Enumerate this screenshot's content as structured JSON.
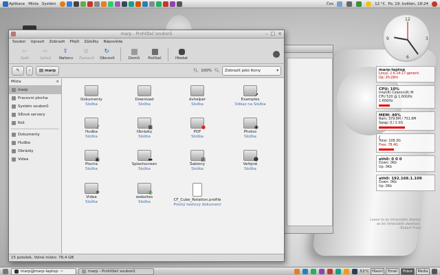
{
  "top_panel": {
    "menus": [
      "Aplikace",
      "Místa",
      "Systém"
    ],
    "keyboard": "Čes",
    "weather": "12 °C",
    "datetime": "Po. 19. květen, 18:24"
  },
  "window": {
    "title": "marp - Prohlížeč souborů",
    "menu": [
      "Soubor",
      "Upravit",
      "Zobrazit",
      "Přejít",
      "Záložky",
      "Nápověda"
    ],
    "toolbar": {
      "back": "Zpět",
      "forward": "Vpřed",
      "up": "Nahoru",
      "stop": "Zastavit",
      "reload": "Obnovit",
      "home": "Domů",
      "computer": "Počítač",
      "search": "Hledat"
    },
    "location": {
      "crumb": "marp",
      "zoom": "100%",
      "view": "Zobrazit jako ikony"
    },
    "sidebar": {
      "header": "Místa",
      "items": [
        "marp",
        "Pracovní plocha",
        "Systém souborů",
        "Síťové servery",
        "Koš"
      ],
      "bookmarks": [
        "Dokumenty",
        "Hudba",
        "Obrázky",
        "Videa"
      ]
    },
    "files": [
      {
        "name": "Dokumenty",
        "type": "Složka"
      },
      {
        "name": "Download",
        "type": "Složka"
      },
      {
        "name": "dvhelper",
        "type": "Složka"
      },
      {
        "name": "Examples",
        "type": "Odkaz na Složka"
      },
      {
        "name": "Hudba",
        "type": "Složka"
      },
      {
        "name": "Obrázky",
        "type": "Složka"
      },
      {
        "name": "PDF",
        "type": "Složka"
      },
      {
        "name": "Photos",
        "type": "Složka"
      },
      {
        "name": "Plocha",
        "type": "Složka"
      },
      {
        "name": "Splashscreen",
        "type": "Složka"
      },
      {
        "name": "Šablony",
        "type": "Složka"
      },
      {
        "name": "Veřejné",
        "type": "Složka"
      },
      {
        "name": "Videa",
        "type": "Složka"
      },
      {
        "name": "websites",
        "type": "Složka"
      },
      {
        "name": "CF_Cube_Rotation.profile",
        "type": "Prostý textový dokument"
      }
    ],
    "status": "15 položek, Volné místo: 78,4 GB"
  },
  "conky": {
    "host": "marp-laptop",
    "kernel": "Linux: 2.6.24-17-generic",
    "uptime": "Up: 2h:28m",
    "cpu": {
      "title": "CPU: 10%",
      "l1": "Intel(R) Celeron(R) M",
      "l2": "CPU   520  @ 1.60GHz",
      "l3": "1.60GHz    "
    },
    "mem": {
      "title": "MEM: 49%",
      "l1": "Ram: 379.9M / 751.6M",
      "l2": "Swap: 0 / 2.0G"
    },
    "disk": {
      "l1": "/",
      "l2": "Total: 108.3G",
      "l3": "Free: 78.4G"
    },
    "eth0": {
      "title": "eth0: 0 0 0",
      "l1": "Down: 0Kb",
      "l2": "Up: 0Kb"
    },
    "ath0": {
      "title": "ath0: 192.168.1.109",
      "l1": "Down: 0Kb",
      "l2": "Up: 0Kb"
    }
  },
  "quote": {
    "l1": "Leave to as intractable dwelon",
    "l2": "as be intractable dawheat.",
    "author": "- Robert Frost"
  },
  "bottom_panel": {
    "tasks": [
      "marp@marp-laptop: ~",
      "marp - Prohlížeč souborů"
    ],
    "temp": "53°C",
    "workspaces": [
      "Hlavní",
      "Email",
      "Práce",
      "Media"
    ]
  }
}
